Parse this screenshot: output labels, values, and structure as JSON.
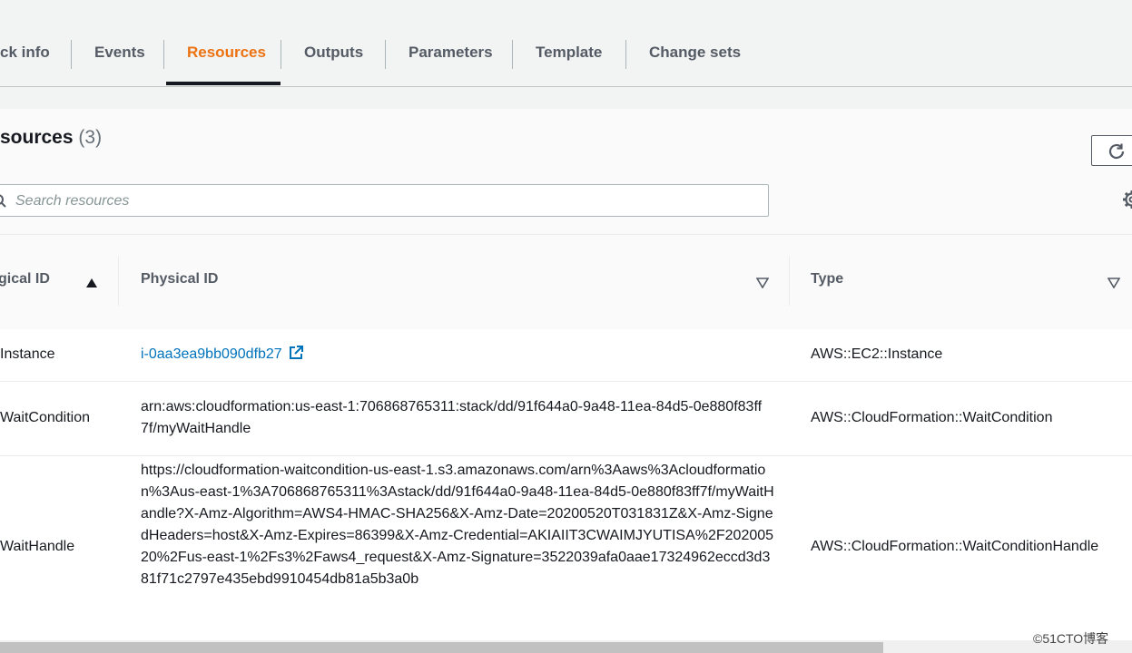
{
  "tabs": [
    {
      "label": "ck info"
    },
    {
      "label": "Events"
    },
    {
      "label": "Resources",
      "active": true
    },
    {
      "label": "Outputs"
    },
    {
      "label": "Parameters"
    },
    {
      "label": "Template"
    },
    {
      "label": "Change sets"
    }
  ],
  "panel": {
    "title": "sources",
    "count": "(3)"
  },
  "search": {
    "placeholder": "Search resources",
    "value": ""
  },
  "table": {
    "columns": [
      {
        "label": "gical ID",
        "sort": "ascending"
      },
      {
        "label": "Physical ID",
        "sort": "none"
      },
      {
        "label": "Type",
        "sort": "none"
      }
    ],
    "rows": [
      {
        "logical_id": "Instance",
        "physical_id": "i-0aa3ea9bb090dfb27",
        "physical_is_link": true,
        "type": "AWS::EC2::Instance"
      },
      {
        "logical_id": "WaitCondition",
        "physical_id": "arn:aws:cloudformation:us-east-1:706868765311:stack/dd/91f644a0-9a48-11ea-84d5-0e880f83ff7f/myWaitHandle",
        "physical_is_link": false,
        "type": "AWS::CloudFormation::WaitCondition"
      },
      {
        "logical_id": "WaitHandle",
        "physical_id": "https://cloudformation-waitcondition-us-east-1.s3.amazonaws.com/arn%3Aaws%3Acloudformation%3Aus-east-1%3A706868765311%3Astack/dd/91f644a0-9a48-11ea-84d5-0e880f83ff7f/myWaitHandle?X-Amz-Algorithm=AWS4-HMAC-SHA256&X-Amz-Date=20200520T031831Z&X-Amz-SignedHeaders=host&X-Amz-Expires=86399&X-Amz-Credential=AKIAIIT3CWAIMJYUTISA%2F20200520%2Fus-east-1%2Fs3%2Faws4_request&X-Amz-Signature=3522039afa0aae17324962eccd3d381f71c2797e435ebd9910454db81a5b3a0b",
        "physical_is_link": false,
        "type": "AWS::CloudFormation::WaitConditionHandle"
      }
    ]
  },
  "watermark": "©51CTO博客",
  "colors": {
    "active_tab": "#ec7211",
    "link": "#0073bb",
    "text": "#16191f",
    "muted": "#545b64"
  },
  "icons": [
    "refresh-icon",
    "search-icon",
    "settings-gear-icon",
    "sort-ascending-icon",
    "sort-descending-icon",
    "external-link-icon"
  ]
}
